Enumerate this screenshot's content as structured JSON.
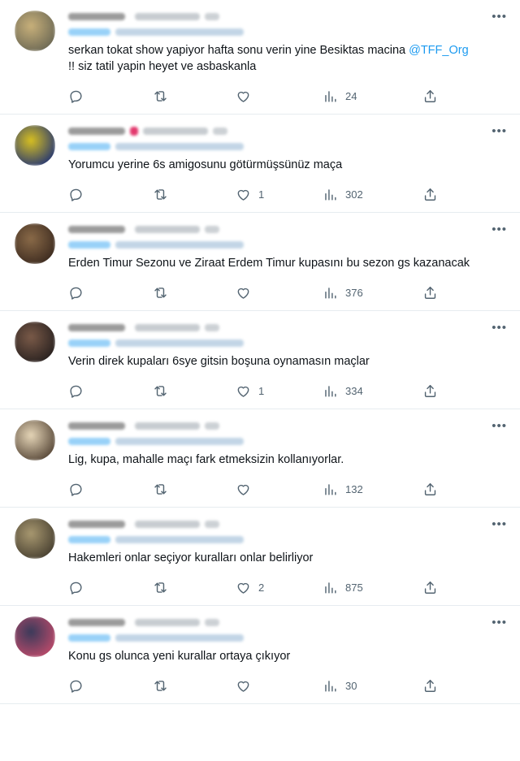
{
  "tweets": [
    {
      "text": "serkan tokat show yapiyor hafta sonu verin yine Besiktas macina ",
      "mention": "@TFF_Org",
      "text_after": "\n!! siz tatil yapin heyet ve asbaskanla",
      "likes": "",
      "views": "24",
      "avatar_colors": [
        "#c8b07a",
        "#6e6a55"
      ],
      "flag": false
    },
    {
      "text": "Yorumcu yerine 6s amigosunu götürmüşsünüz maça",
      "mention": "",
      "text_after": "",
      "likes": "1",
      "views": "302",
      "avatar_colors": [
        "#d8c020",
        "#2a3a70"
      ],
      "flag": true
    },
    {
      "text": "Erden Timur Sezonu ve Ziraat Erdem Timur kupasını bu sezon gs kazanacak",
      "mention": "",
      "text_after": "",
      "likes": "",
      "views": "376",
      "avatar_colors": [
        "#8a6a48",
        "#3e2c20"
      ],
      "flag": false
    },
    {
      "text": "Verin direk kupaları 6sye gitsin boşuna oynamasın maçlar",
      "mention": "",
      "text_after": "",
      "likes": "1",
      "views": "334",
      "avatar_colors": [
        "#7a5a48",
        "#2a2220"
      ],
      "flag": false
    },
    {
      "text": "Lig, kupa, mahalle maçı fark etmeksizin kollanıyorlar.",
      "mention": "",
      "text_after": "",
      "likes": "",
      "views": "132",
      "avatar_colors": [
        "#e6d6b8",
        "#5a4a3a"
      ],
      "flag": false
    },
    {
      "text": "Hakemleri onlar seçiyor kuralları onlar belirliyor",
      "mention": "",
      "text_after": "",
      "likes": "2",
      "views": "875",
      "avatar_colors": [
        "#a89870",
        "#4a4232"
      ],
      "flag": false
    },
    {
      "text": "Konu gs olunca yeni kurallar ortaya çıkıyor",
      "mention": "",
      "text_after": "",
      "likes": "",
      "views": "30",
      "avatar_colors": [
        "#3a3a5a",
        "#b84a6a"
      ],
      "flag": false
    }
  ],
  "icons": {
    "more": "more-icon",
    "reply": "reply-icon",
    "retweet": "retweet-icon",
    "like": "heart-icon",
    "views": "views-icon",
    "share": "share-icon"
  },
  "colors": {
    "link": "#1d9bf0",
    "muted": "#536471",
    "divider": "#e6ecf0",
    "flag": "#e0245e"
  }
}
